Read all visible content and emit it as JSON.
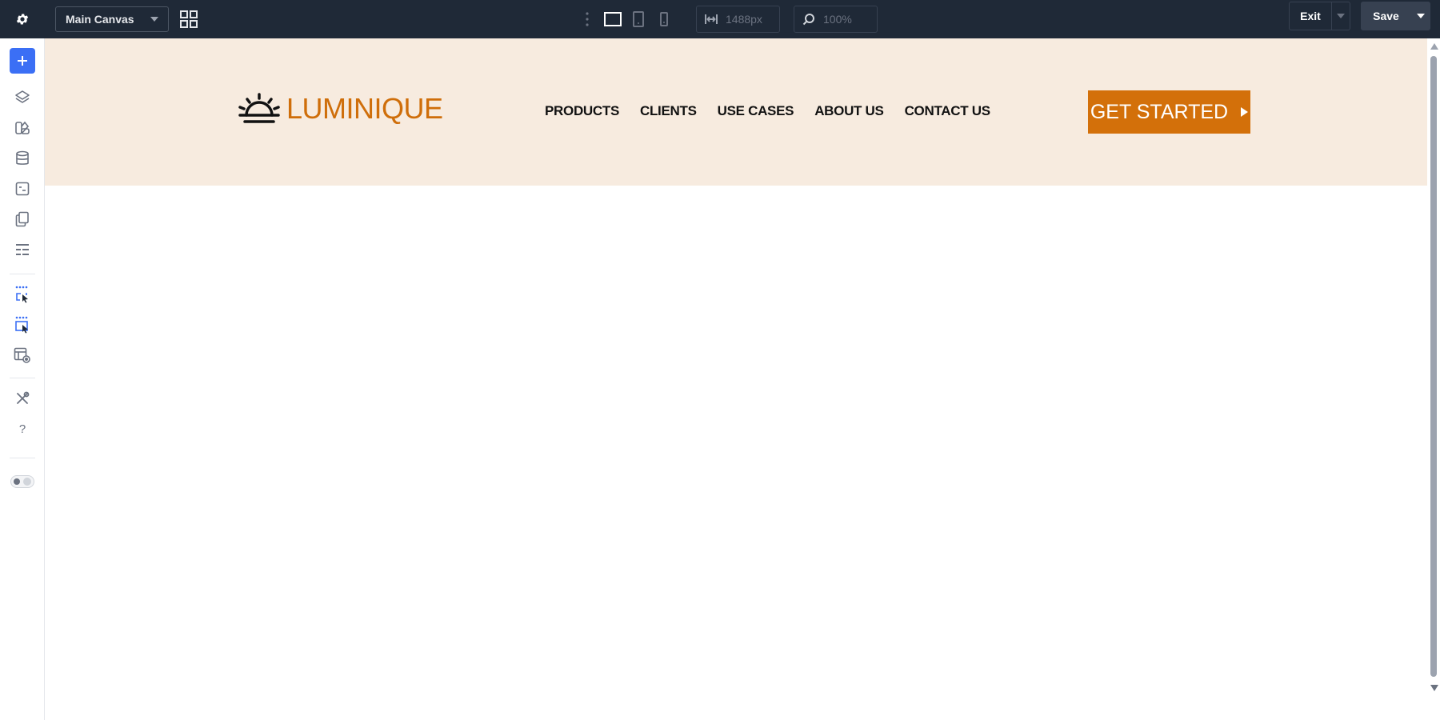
{
  "toolbar": {
    "settings_icon": "gear-icon",
    "canvas_select": "Main Canvas",
    "width_value": "1488px",
    "zoom_value": "100%",
    "exit_label": "Exit",
    "save_label": "Save"
  },
  "sidebar": {
    "icons": [
      "plus-icon",
      "layers-icon",
      "components-icon",
      "database-icon",
      "form-icon",
      "pages-icon",
      "sections-icon",
      "select-element-icon",
      "select-elements-icon",
      "template-view-icon",
      "tools-icon",
      "help-icon"
    ],
    "help_label": "?"
  },
  "site": {
    "logo_text": "LUMINIQUE",
    "nav": [
      "PRODUCTS",
      "CLIENTS",
      "USE CASES",
      "ABOUT US",
      "CONTACT US"
    ],
    "cta_label": "GET STARTED"
  },
  "colors": {
    "topbar": "#1f2937",
    "accent_blue": "#3b6ff5",
    "header_bg": "#f7ebdf",
    "brand_orange": "#d3700a"
  }
}
